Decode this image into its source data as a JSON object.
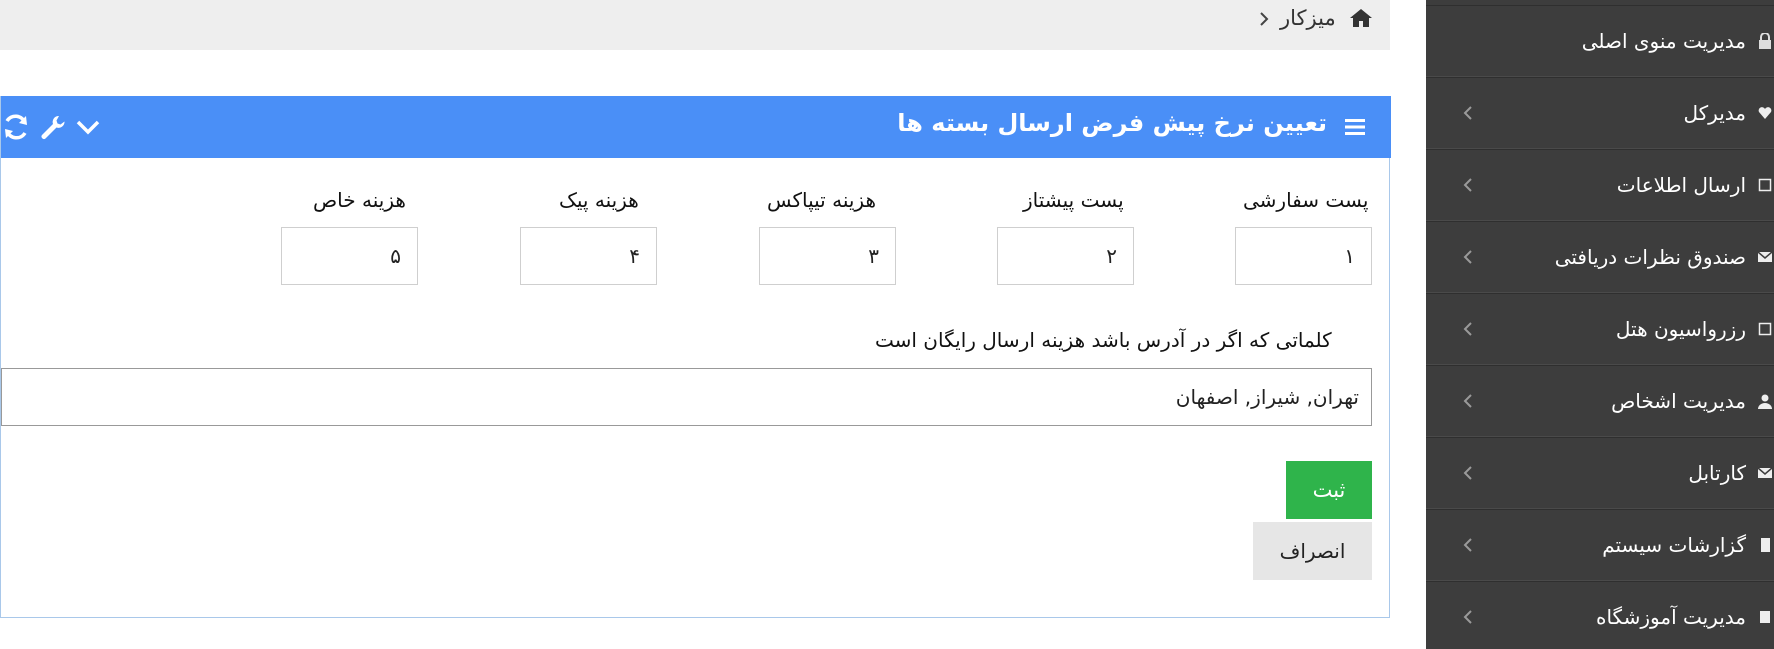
{
  "breadcrumb": {
    "home_label": "میزکار",
    "home_icon": "home-icon"
  },
  "panel": {
    "title": "تعیین نرخ پیش فرض ارسال بسته ها",
    "header_color": "#4a8ff7",
    "tools": [
      "chevron-down-icon",
      "wrench-icon",
      "refresh-icon"
    ]
  },
  "form": {
    "fields": [
      {
        "label": "پست سفارشی",
        "value": "۱"
      },
      {
        "label": "پست پیشتاز",
        "value": "۲"
      },
      {
        "label": "هزینه تیپاکس",
        "value": "۳"
      },
      {
        "label": "هزینه پیک",
        "value": "۴"
      },
      {
        "label": "هزینه خاص",
        "value": "۵"
      }
    ],
    "free_words_label": "کلماتی که اگر در آدرس باشد هزینه ارسال رایگان است",
    "free_words_value": "تهران, شیراز, اصفهان",
    "submit_label": "ثبت",
    "cancel_label": "انصراف",
    "submit_color": "#2fb44b"
  },
  "sidebar": {
    "background": "#3d3d3d",
    "items": [
      {
        "label": "مدیریت منوی اصلی",
        "icon": "lock-icon"
      },
      {
        "label": "مدیرکل",
        "icon": "heart-icon"
      },
      {
        "label": "ارسال اطلاعات",
        "icon": "checkbox-icon"
      },
      {
        "label": "صندوق نظرات دریافتی",
        "icon": "envelope-icon"
      },
      {
        "label": "رزرواسیون هتل",
        "icon": "checkbox-icon"
      },
      {
        "label": "مدیریت اشخاص",
        "icon": "user-icon"
      },
      {
        "label": "کارتابل",
        "icon": "envelope-icon"
      },
      {
        "label": "گزارشات سیستم",
        "icon": "file-icon"
      },
      {
        "label": "مدیریت آموزشگاه",
        "icon": "book-icon"
      }
    ]
  }
}
